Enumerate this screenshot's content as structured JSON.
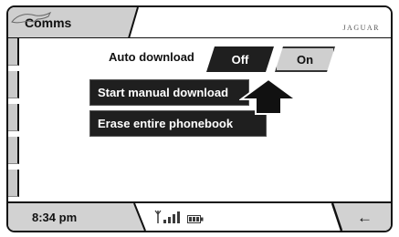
{
  "header": {
    "title": "Comms",
    "brand": "JAGUAR"
  },
  "settings": {
    "auto_download": {
      "label": "Auto download",
      "options": [
        "Off",
        "On"
      ],
      "selected": "Off"
    }
  },
  "actions": {
    "manual_download": "Start manual download",
    "erase_phonebook": "Erase entire phonebook"
  },
  "status": {
    "time": "8:34 pm",
    "signal_icon": "signal-bars-icon",
    "battery_icon": "battery-icon",
    "back_icon": "back-arrow-icon",
    "back_symbol": "←"
  },
  "colors": {
    "panel_dark": "#1f1f1f",
    "panel_grey": "#d2d2d2",
    "selected_grey": "#cfcfcf"
  }
}
